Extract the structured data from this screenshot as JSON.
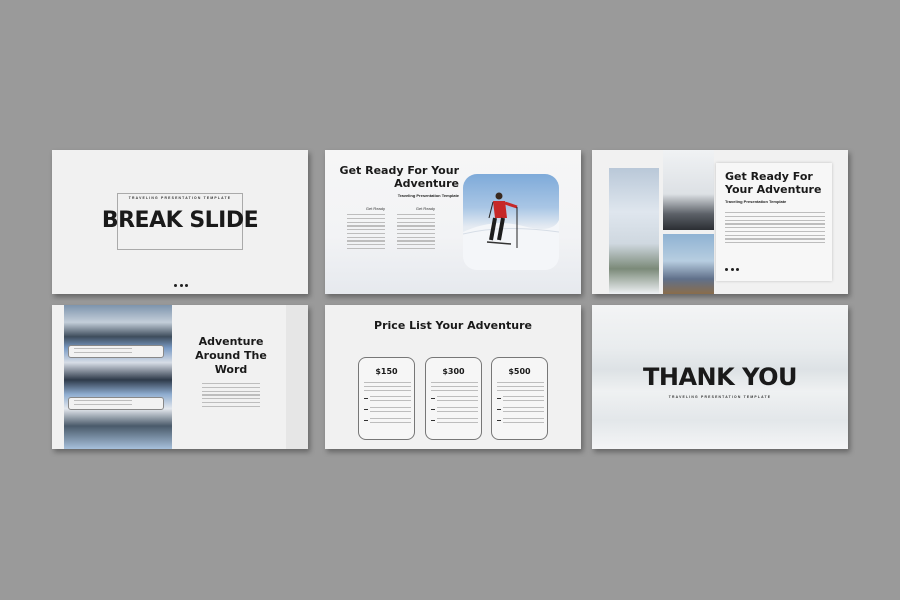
{
  "colors": {
    "background": "#9a9a9a",
    "slide": "#f1f1f1",
    "text": "#1a1a1a"
  },
  "slide1": {
    "subtitle": "TRAVELING PRESENTATION TEMPLATE",
    "title": "BREAK SLIDE"
  },
  "slide2": {
    "title": "Get Ready For Your Adventure",
    "subtitle": "Traveling Presentation Template",
    "col1_heading": "Get Ready",
    "col2_heading": "Get Ready"
  },
  "slide3": {
    "title": "Get Ready For Your Adventure",
    "subtitle": "Traveling Presentation Template"
  },
  "slide4": {
    "title": "Adventure Around The Word"
  },
  "slide5": {
    "title": "Price List Your Adventure",
    "prices": [
      "$150",
      "$300",
      "$500"
    ]
  },
  "slide6": {
    "title": "THANK YOU",
    "subtitle": "TRAVELING PRESENTATION TEMPLATE"
  }
}
